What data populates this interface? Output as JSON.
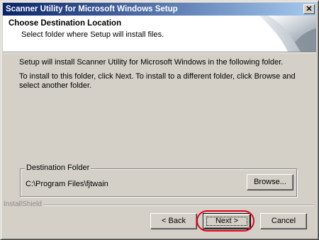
{
  "window": {
    "title": "Scanner Utility for Microsoft Windows Setup",
    "close_symbol": "✕"
  },
  "header": {
    "title": "Choose Destination Location",
    "subtitle": "Select folder where Setup will install files."
  },
  "body": {
    "line1": "Setup will install Scanner Utility for Microsoft Windows in the following folder.",
    "line2": "To install to this folder, click Next. To install to a different folder, click Browse and select another folder."
  },
  "destination": {
    "group_label": "Destination Folder",
    "path": "C:\\Program Files\\fjtwain",
    "browse_label": "Browse..."
  },
  "footer": {
    "brand": "InstallShield",
    "back_label": "< Back",
    "next_label": "Next >",
    "cancel_label": "Cancel"
  },
  "annotation": {
    "highlight_color": "#e3001b"
  }
}
